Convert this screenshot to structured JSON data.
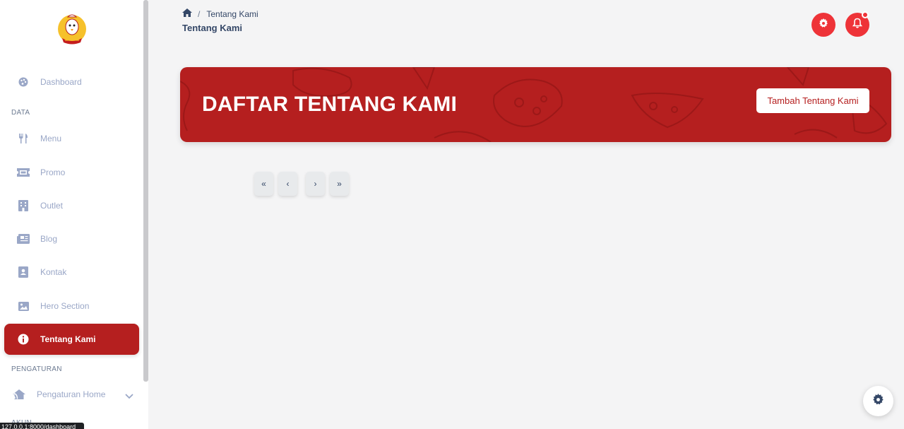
{
  "colors": {
    "accent": "#b51f1f",
    "header_button": "#ee3338",
    "sidebar_text": "#9aa7c7",
    "page_bg": "#f4f4f5"
  },
  "sidebar": {
    "logo_icon": "chicken-mascot-logo",
    "items": [
      {
        "label": "Dashboard",
        "icon": "palette-icon"
      },
      {
        "label": "Menu",
        "icon": "utensils-icon"
      },
      {
        "label": "Promo",
        "icon": "ticket-icon"
      },
      {
        "label": "Outlet",
        "icon": "building-icon"
      },
      {
        "label": "Blog",
        "icon": "newspaper-icon"
      },
      {
        "label": "Kontak",
        "icon": "contact-card-icon"
      },
      {
        "label": "Hero Section",
        "icon": "image-icon"
      },
      {
        "label": "Tentang Kami",
        "icon": "info-icon",
        "active": true
      },
      {
        "label": "Pengaturan Home",
        "icon": "home-wifi-icon"
      }
    ],
    "sections": {
      "data": "DATA",
      "settings": "PENGATURAN",
      "account": "AKUN"
    },
    "status_url": "127.0.0.1:8000/dashboard"
  },
  "header": {
    "breadcrumb_current": "Tentang Kami",
    "page_title": "Tentang Kami"
  },
  "banner": {
    "title": "DAFTAR TENTANG KAMI",
    "add_button": "Tambah Tentang Kami"
  },
  "pagination": {
    "first": "«",
    "prev": "‹",
    "next": "›",
    "last": "»"
  }
}
